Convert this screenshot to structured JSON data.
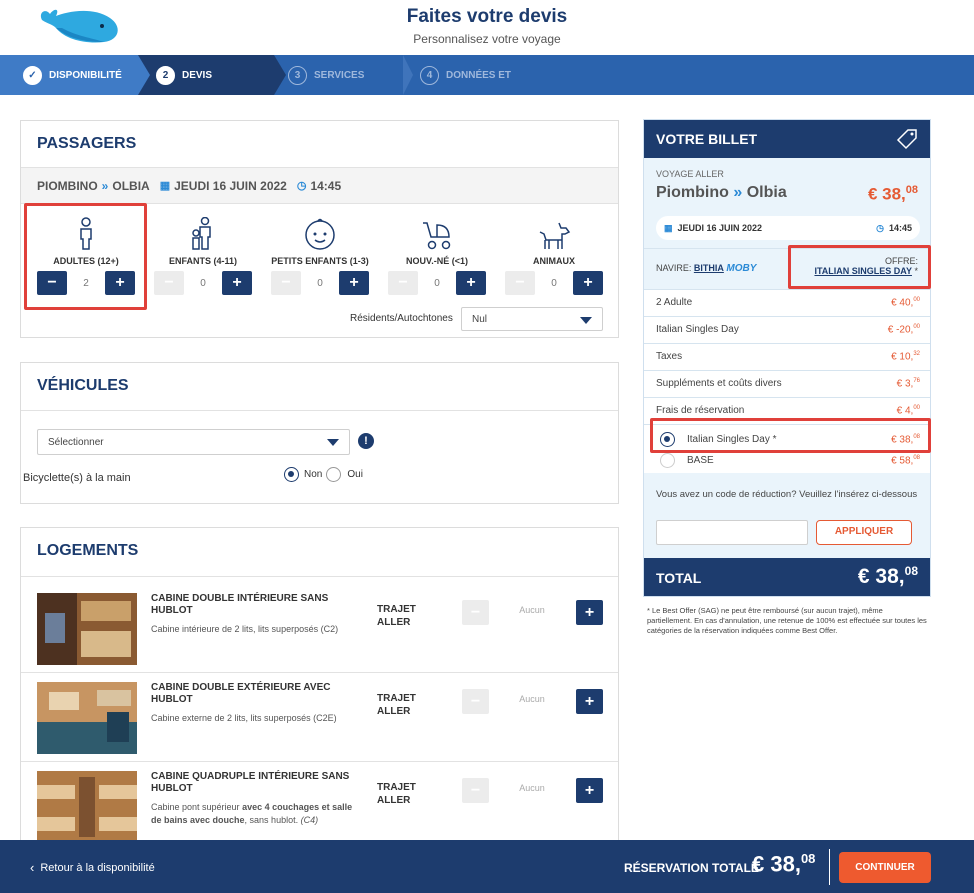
{
  "header": {
    "title": "Faites votre devis",
    "subtitle": "Personnalisez votre voyage"
  },
  "stepper": {
    "steps": [
      {
        "num": "✓",
        "label": "Disponibilité"
      },
      {
        "num": "2",
        "label": "Devis"
      },
      {
        "num": "3",
        "label": "Services"
      },
      {
        "num": "4",
        "label": "Données et"
      }
    ]
  },
  "passengers": {
    "title": "Passagers",
    "route_from": "PIOMBINO",
    "route_to": "OLBIA",
    "date": "JEUDI 16 JUIN 2022",
    "time": "14:45",
    "types": [
      {
        "label": "Adultes (12+)",
        "value": "2",
        "icon": "adult-icon"
      },
      {
        "label": "Enfants (4-11)",
        "value": "0",
        "icon": "child-icon"
      },
      {
        "label": "Petits enfants (1-3)",
        "value": "0",
        "icon": "baby-face-icon"
      },
      {
        "label": "Nouv.-né (<1)",
        "value": "0",
        "icon": "stroller-icon"
      },
      {
        "label": "Animaux",
        "value": "0",
        "icon": "dog-icon"
      }
    ],
    "residents_label": "Résidents/Autochtones",
    "residents_value": "Nul"
  },
  "vehicles": {
    "title": "Véhicules",
    "select_placeholder": "Sélectionner",
    "bicycle_label": "Bicyclette(s) à la main",
    "no_label": "Non",
    "yes_label": "Oui"
  },
  "accommodations": {
    "title": "Logements",
    "items": [
      {
        "title": "Cabine double intérieure sans hublot",
        "desc": "Cabine intérieure de 2 lits, lits superposés (C2)",
        "trajet": "TRAJET ALLER",
        "value": "Aucun"
      },
      {
        "title": "Cabine double extérieure avec hublot",
        "desc": "Cabine externe de 2 lits, lits superposés (C2E)",
        "trajet": "TRAJET ALLER",
        "value": "Aucun"
      },
      {
        "title": "Cabine quadruple intérieure sans hublot",
        "desc_prefix": "Cabine pont supérieur ",
        "desc_bold": "avec 4 couchages et salle de bains avec douche",
        "desc_suffix": ", sans hublot. ",
        "desc_code": "(C4)",
        "trajet": "TRAJET ALLER",
        "value": "Aucun"
      }
    ]
  },
  "ticket": {
    "title": "Votre billet",
    "voyage_label": "VOYAGE ALLER",
    "route_from": "Piombino",
    "route_to": "Olbia",
    "price_main": "€ 38,",
    "price_cents": "08",
    "date": "JEUDI 16 JUIN 2022",
    "time": "14:45",
    "ship_label": "NAVIRE:",
    "ship_name": "BITHIA",
    "company": "MOBY",
    "offer_label": "OFFRE:",
    "offer_name": "ITALIAN SINGLES DAY",
    "offer_star": "*",
    "lines": [
      {
        "label": "2 Adulte",
        "amount": "€ 40,",
        "cents": "00"
      },
      {
        "label": "Italian Singles Day",
        "amount": "€ -20,",
        "cents": "00"
      },
      {
        "label": "Taxes",
        "amount": "€ 10,",
        "cents": "32"
      },
      {
        "label": "Suppléments et coûts divers",
        "amount": "€ 3,",
        "cents": "76"
      },
      {
        "label": "Frais de réservation",
        "amount": "€ 4,",
        "cents": "00"
      }
    ],
    "fares": [
      {
        "label": "Italian Singles Day *",
        "amount": "€ 38,",
        "cents": "08",
        "selected": true
      },
      {
        "label": "BASE",
        "amount": "€ 58,",
        "cents": "08",
        "selected": false
      }
    ],
    "promo_text": "Vous avez un code de réduction? Veuillez l'insérez ci-dessous",
    "apply_label": "APPLIQUER",
    "total_label": "TOTAL",
    "total_main": "€ 38,",
    "total_cents": "08"
  },
  "disclaimer": "* Le Best Offer (SAG) ne peut être remboursé (sur aucun trajet), même partiellement. En cas d'annulation, une retenue de 100% est effectuée sur toutes les catégories de la réservation indiquées comme Best Offer.",
  "footer": {
    "back_label": "Retour à la disponibilité",
    "total_label": "RÉSERVATION TOTALE",
    "total_main": "€ 38,",
    "total_cents": "08",
    "continue_label": "CONTINUER"
  },
  "colors": {
    "navy": "#1d3c6e",
    "blue": "#2b63ad",
    "accent_orange": "#e55a34",
    "highlight_red": "#e0403a",
    "ticket_bg": "#eaf4fb"
  }
}
